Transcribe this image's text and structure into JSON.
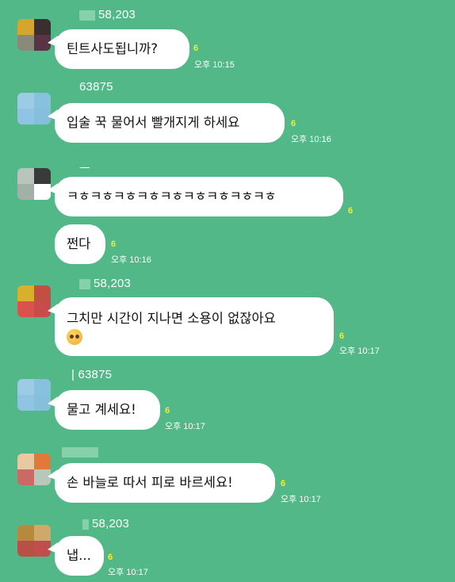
{
  "colors": {
    "background": "#52b887",
    "bubble": "#ffffff",
    "unread": "#f7ec2c",
    "meta_text": "#ffffff"
  },
  "messages": [
    {
      "sender": "58,203",
      "avatar_colors": [
        "#d6a52b",
        "#3a2e30",
        "#8a8a7a",
        "#5a3346"
      ],
      "bubbles": [
        {
          "text": "틴트사도됩니까?",
          "unread": "6",
          "time": "오후 10:15"
        }
      ]
    },
    {
      "sender": "63875",
      "avatar_colors": [
        "#9ccbe6",
        "#88c1de",
        "#8fc4e3",
        "#86bfdc"
      ],
      "bubbles": [
        {
          "text": "입술 꾹 물어서 빨개지게 하세요",
          "unread": "6",
          "time": "오후 10:16"
        }
      ]
    },
    {
      "sender": "ㅡ",
      "avatar_colors": [
        "#b8c4bc",
        "#3a3a3a",
        "#a3b0a8",
        "#ffffff"
      ],
      "bubbles": [
        {
          "text": "ㅋㅎㅋㅎㅋㅎㅋㅎㅋㅎㅋㅎㅋㅎㅋㅎㅋㅎ",
          "unread": "6",
          "time": ""
        },
        {
          "text": "쩐다",
          "unread": "6",
          "time": "오후 10:16"
        }
      ]
    },
    {
      "sender": "58,203",
      "avatar_colors": [
        "#d8b02c",
        "#c24f43",
        "#d9524c",
        "#c94c4c"
      ],
      "bubbles": [
        {
          "text": "그치만 시간이 지나면 소용이 없잖아요",
          "emoji": "pleading-face",
          "unread": "6",
          "time": "오후 10:17"
        }
      ]
    },
    {
      "sender": "| 63875",
      "avatar_colors": [
        "#9ccbe6",
        "#88c1de",
        "#8fc4e3",
        "#86bfdc"
      ],
      "bubbles": [
        {
          "text": "물고 계세요!",
          "unread": "6",
          "time": "오후 10:17"
        }
      ]
    },
    {
      "sender": "",
      "avatar_colors": [
        "#e9c9a1",
        "#e0793a",
        "#c96a64",
        "#b7c7b9"
      ],
      "bubbles": [
        {
          "text": "손 바늘로 따서 피로 바르세요!",
          "unread": "6",
          "time": "오후 10:17"
        }
      ]
    },
    {
      "sender": "58,203",
      "avatar_colors": [
        "#b68a3c",
        "#d0a96a",
        "#b94f45",
        "#c24d4d"
      ],
      "bubbles": [
        {
          "text": "냅...",
          "unread": "6",
          "time": "오후 10:17"
        }
      ]
    }
  ]
}
